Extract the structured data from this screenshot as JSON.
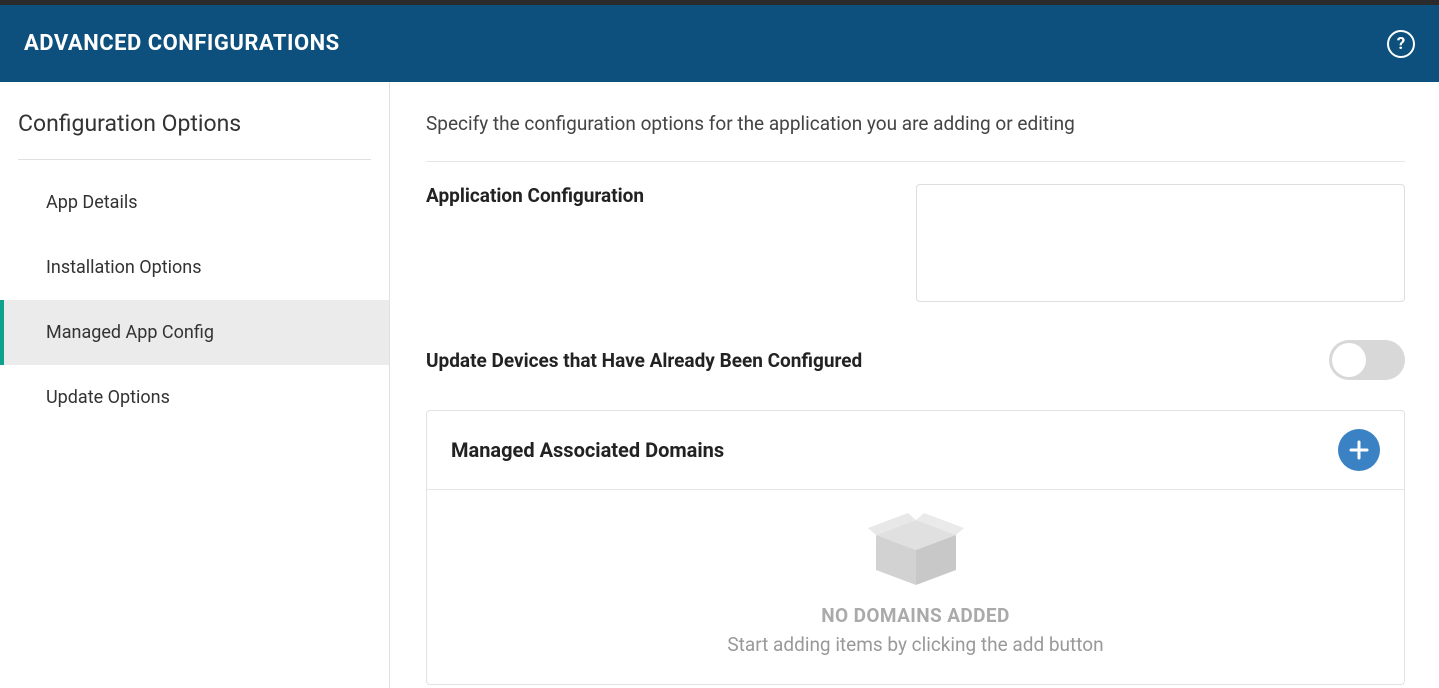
{
  "header": {
    "title": "ADVANCED CONFIGURATIONS"
  },
  "sidebar": {
    "heading": "Configuration Options",
    "items": [
      {
        "label": "App Details",
        "selected": false
      },
      {
        "label": "Installation Options",
        "selected": false
      },
      {
        "label": "Managed App Config",
        "selected": true
      },
      {
        "label": "Update Options",
        "selected": false
      }
    ]
  },
  "main": {
    "description": "Specify the configuration options for the application you are adding or editing",
    "app_config_label": "Application Configuration",
    "app_config_value": "",
    "update_devices_label": "Update Devices that Have Already Been Configured",
    "update_devices_on": false,
    "domains": {
      "title": "Managed Associated Domains",
      "empty_title": "NO DOMAINS ADDED",
      "empty_sub": "Start adding items by clicking the add button"
    }
  }
}
